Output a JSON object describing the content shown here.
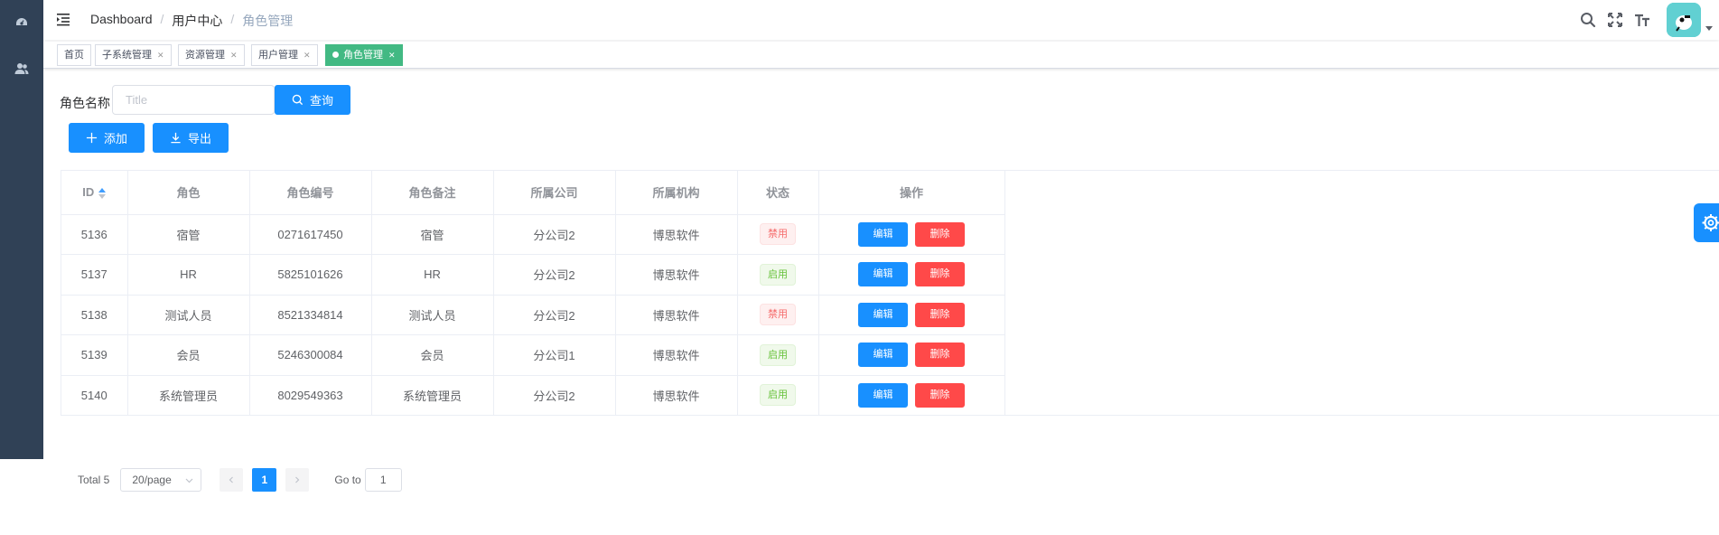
{
  "breadcrumb": [
    "Dashboard",
    "用户中心",
    "角色管理"
  ],
  "tags": [
    {
      "label": "首页",
      "closable": false,
      "active": false
    },
    {
      "label": "子系统管理",
      "closable": true,
      "active": false
    },
    {
      "label": "资源管理",
      "closable": true,
      "active": false
    },
    {
      "label": "用户管理",
      "closable": true,
      "active": false
    },
    {
      "label": "角色管理",
      "closable": true,
      "active": true
    }
  ],
  "search": {
    "label": "角色名称",
    "placeholder": "Title",
    "button": "查询"
  },
  "toolbar": {
    "add": "添加",
    "export": "导出"
  },
  "table": {
    "headers": [
      "ID",
      "角色",
      "角色编号",
      "角色备注",
      "所属公司",
      "所属机构",
      "状态",
      "操作"
    ],
    "rows": [
      {
        "id": "5136",
        "role": "宿管",
        "code": "0271617450",
        "remark": "宿管",
        "company": "分公司2",
        "org": "博思软件",
        "status": "禁用",
        "status_type": "off"
      },
      {
        "id": "5137",
        "role": "HR",
        "code": "5825101626",
        "remark": "HR",
        "company": "分公司2",
        "org": "博思软件",
        "status": "启用",
        "status_type": "on"
      },
      {
        "id": "5138",
        "role": "测试人员",
        "code": "8521334814",
        "remark": "测试人员",
        "company": "分公司2",
        "org": "博思软件",
        "status": "禁用",
        "status_type": "off"
      },
      {
        "id": "5139",
        "role": "会员",
        "code": "5246300084",
        "remark": "会员",
        "company": "分公司1",
        "org": "博思软件",
        "status": "启用",
        "status_type": "on"
      },
      {
        "id": "5140",
        "role": "系统管理员",
        "code": "8029549363",
        "remark": "系统管理员",
        "company": "分公司2",
        "org": "博思软件",
        "status": "启用",
        "status_type": "on"
      }
    ],
    "edit_label": "编辑",
    "delete_label": "删除"
  },
  "pagination": {
    "total": "Total 5",
    "page_size": "20/page",
    "current_page": "1",
    "goto_label": "Go to",
    "goto_value": "1"
  },
  "colors": {
    "primary": "#1890ff",
    "sidebar": "#304156",
    "active_tag": "#42b983",
    "danger": "#ff4949"
  },
  "icons": [
    "dashboard-icon",
    "user-group-icon",
    "hamburger-icon",
    "search-icon",
    "fullscreen-icon",
    "font-size-icon",
    "gear-icon"
  ]
}
